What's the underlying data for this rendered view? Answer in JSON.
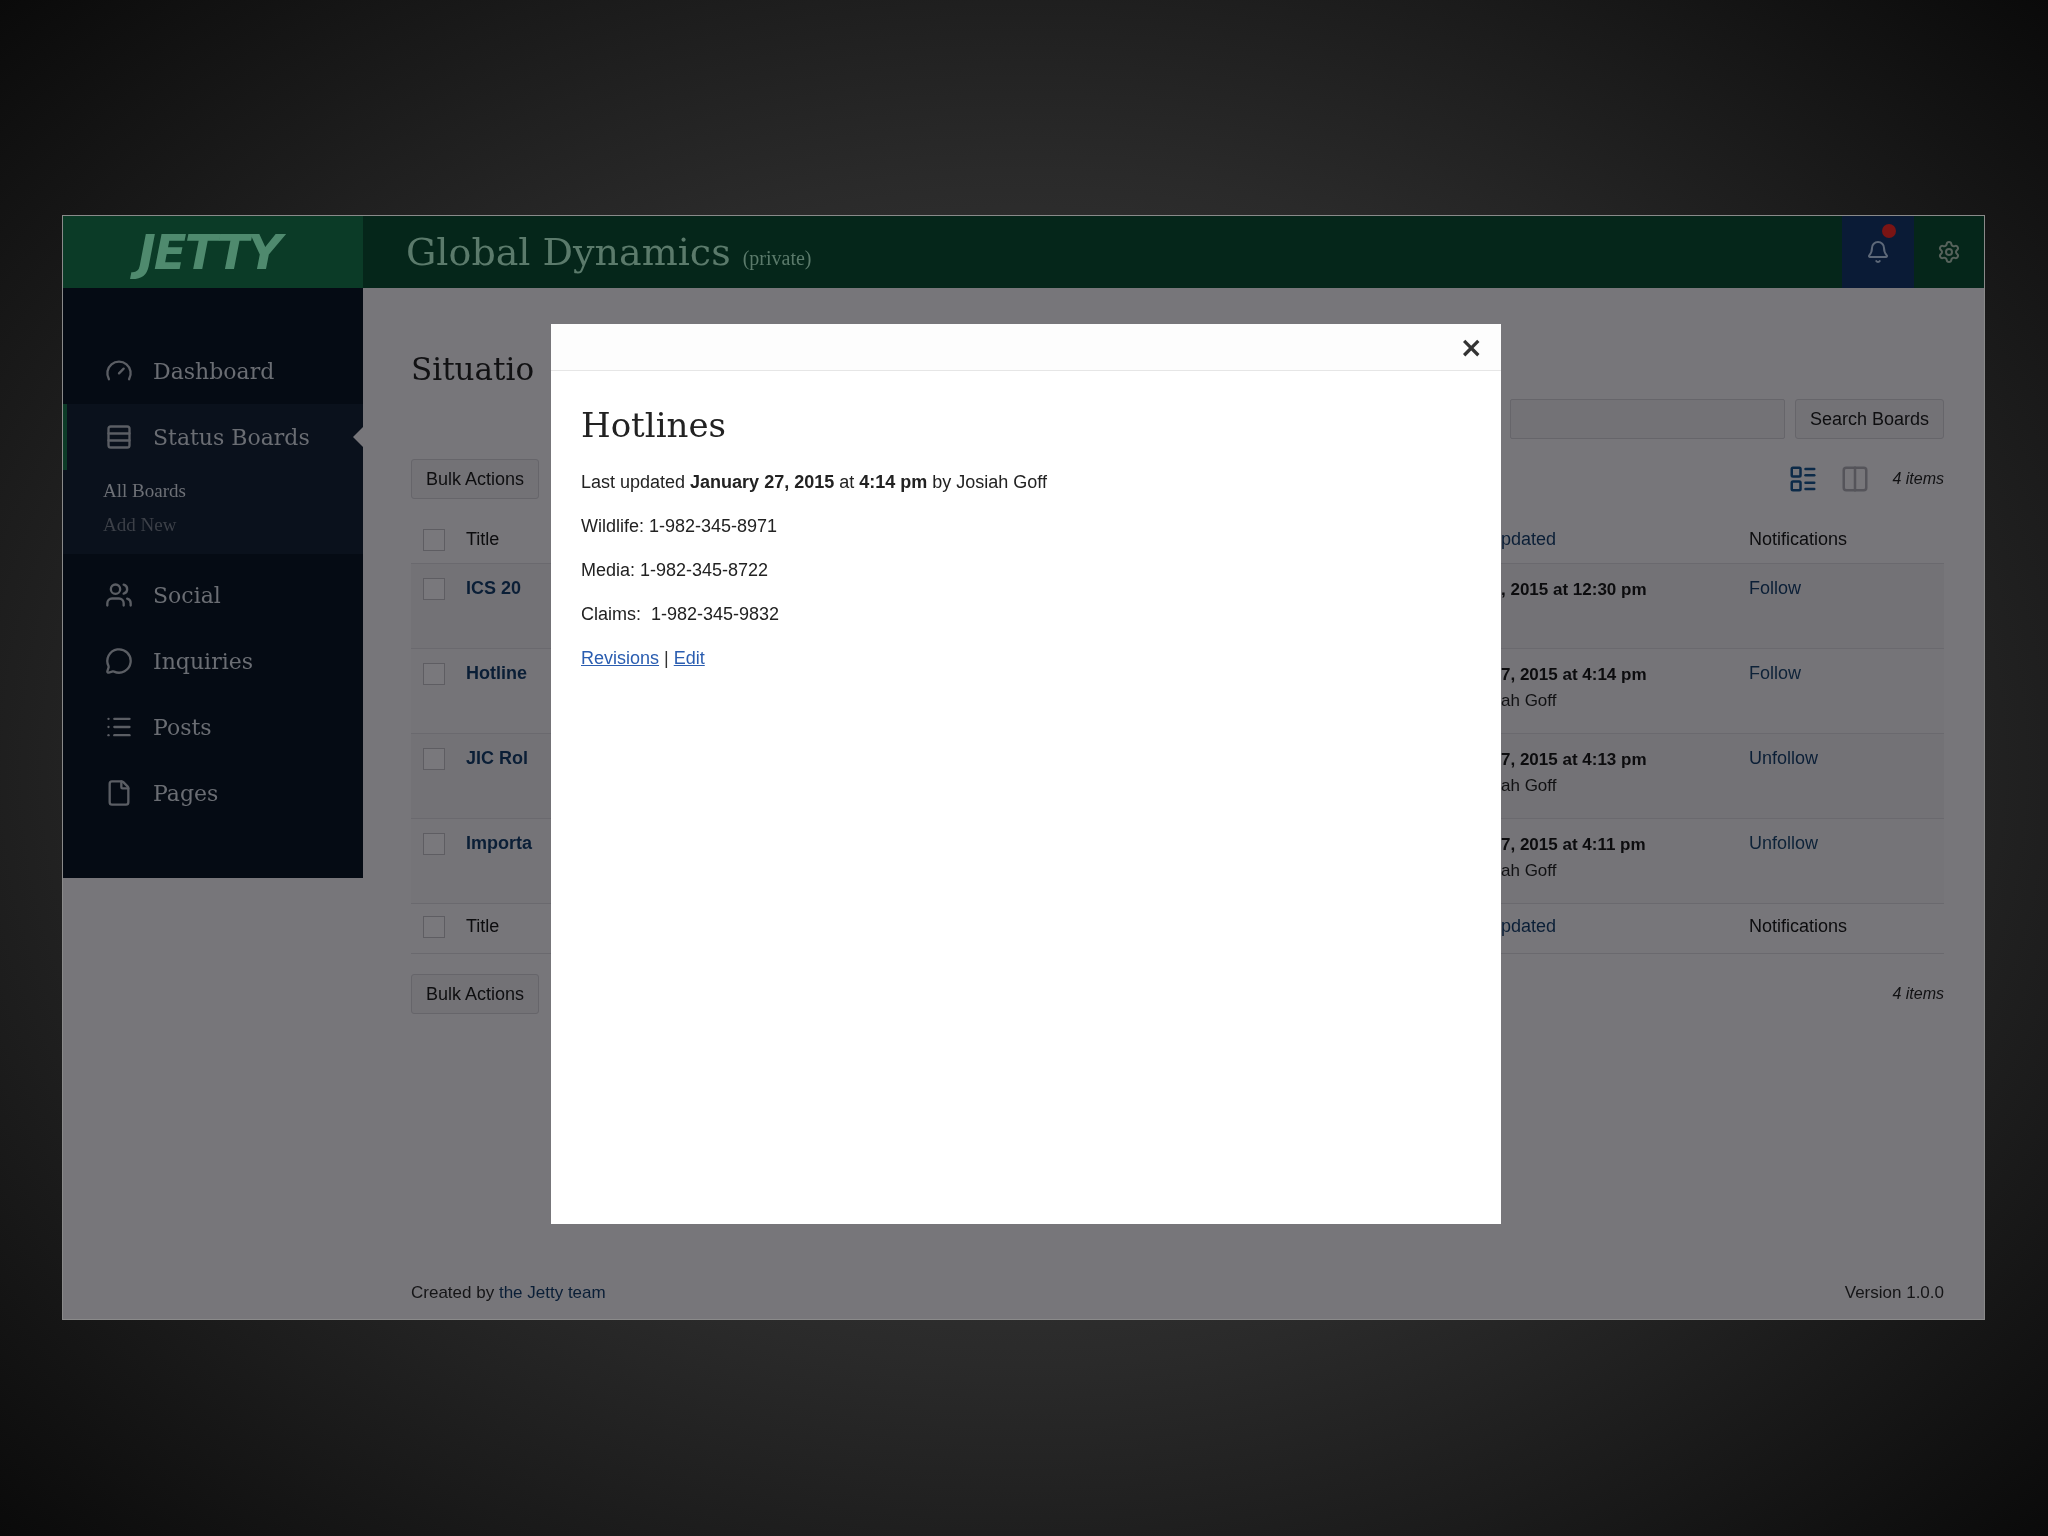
{
  "header": {
    "logo": "JETTY",
    "site_title": "Global Dynamics",
    "site_visibility": "(private)",
    "notifications_unread": true
  },
  "sidebar": {
    "items": [
      {
        "label": "Dashboard",
        "selected": false
      },
      {
        "label": "Status Boards",
        "selected": true,
        "children": [
          {
            "label": "All Boards",
            "selected": true
          },
          {
            "label": "Add New",
            "selected": false
          }
        ]
      },
      {
        "label": "Social",
        "selected": false
      },
      {
        "label": "Inquiries",
        "selected": false
      },
      {
        "label": "Posts",
        "selected": false
      },
      {
        "label": "Pages",
        "selected": false
      }
    ]
  },
  "page": {
    "title": "Situatio",
    "search_button": "Search Boards",
    "bulk_actions_top": "Bulk Actions",
    "item_count_top": "4 items",
    "bulk_actions_bottom": "Bulk Actions",
    "item_count_bottom": "4 items",
    "view_modes": [
      {
        "kind": "list",
        "selected": true
      },
      {
        "kind": "grid",
        "selected": false
      }
    ]
  },
  "table": {
    "header_checked": false,
    "footer_checked": false,
    "columns": [
      "Title",
      "pdated",
      "Notifications"
    ],
    "rows": [
      {
        "checked": false,
        "title": "ICS 20",
        "updated": ", 2015 at 12:30 pm",
        "notification": "Follow"
      },
      {
        "checked": false,
        "title": "Hotline",
        "updated": "7, 2015 at 4:14 pm",
        "author": "ah Goff",
        "notification": "Follow"
      },
      {
        "checked": false,
        "title": "JIC Rol",
        "updated": "7, 2015 at 4:13 pm",
        "author": "ah Goff",
        "notification": "Unfollow"
      },
      {
        "checked": false,
        "title": "Importa",
        "updated": "7, 2015 at 4:11 pm",
        "author": "ah Goff",
        "notification": "Unfollow"
      }
    ],
    "footer_columns": [
      "Title",
      "pdated",
      "Notifications"
    ]
  },
  "footer": {
    "credit_prefix": "Created by",
    "credit_link": "the Jetty team",
    "version": "Version 1.0.0"
  },
  "modal": {
    "close": "×",
    "title": "Hotlines",
    "meta": "Last updated **January 27, 2015** at **4:14 pm** by Josiah Goff",
    "lines": [
      "Wildlife: 1-982-345-8971",
      "Media: 1-982-345-8722",
      "Claims:  1-982-345-9832"
    ],
    "links": [
      "Revisions",
      "Edit"
    ],
    "separator": "|"
  }
}
